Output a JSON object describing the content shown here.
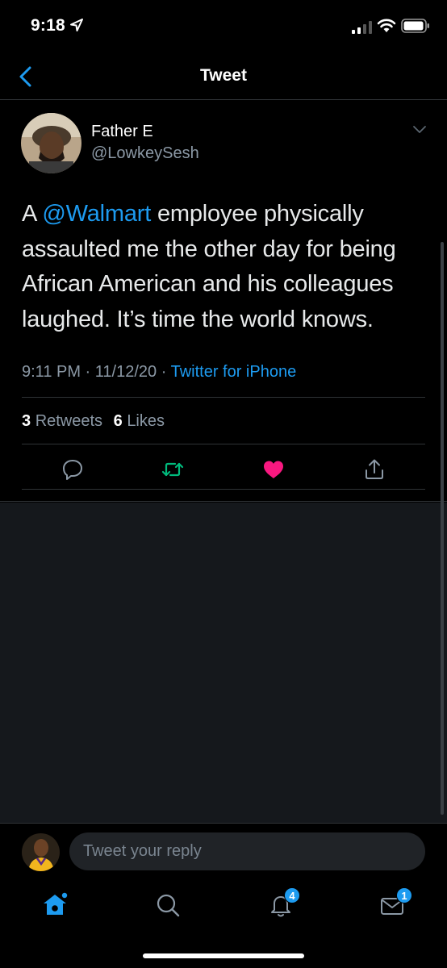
{
  "status_bar": {
    "time": "9:18",
    "icons": [
      "location-arrow-icon",
      "cellular-signal-icon",
      "wifi-icon",
      "battery-icon"
    ]
  },
  "nav": {
    "title": "Tweet",
    "back_icon": "chevron-left-icon"
  },
  "tweet": {
    "author_name": "Father E",
    "author_handle": "@LowkeySesh",
    "text_prefix": "A ",
    "mention": "@Walmart",
    "text_suffix": " employee physically assaulted me the other day for being African American and his colleagues laughed. It’s time the world knows.",
    "time": "9:11 PM",
    "separator": " · ",
    "date": "11/12/20",
    "source": "Twitter for iPhone",
    "retweets_count": "3",
    "retweets_label": "Retweets",
    "likes_count": "6",
    "likes_label": "Likes",
    "liked": true,
    "retweeted": true
  },
  "actions": [
    "reply-icon",
    "retweet-icon",
    "like-icon",
    "share-icon"
  ],
  "reply": {
    "placeholder": "Tweet your reply"
  },
  "tab_bar": {
    "tabs": [
      "home-icon",
      "search-icon",
      "notifications-icon",
      "messages-icon"
    ],
    "notifications_badge": "4",
    "messages_badge": "1"
  },
  "colors": {
    "background": "#000000",
    "accent": "#1d9bf0",
    "retweet": "#00ba7c",
    "like": "#f91880",
    "muted": "#8b98a5",
    "divider": "#2f3336"
  }
}
